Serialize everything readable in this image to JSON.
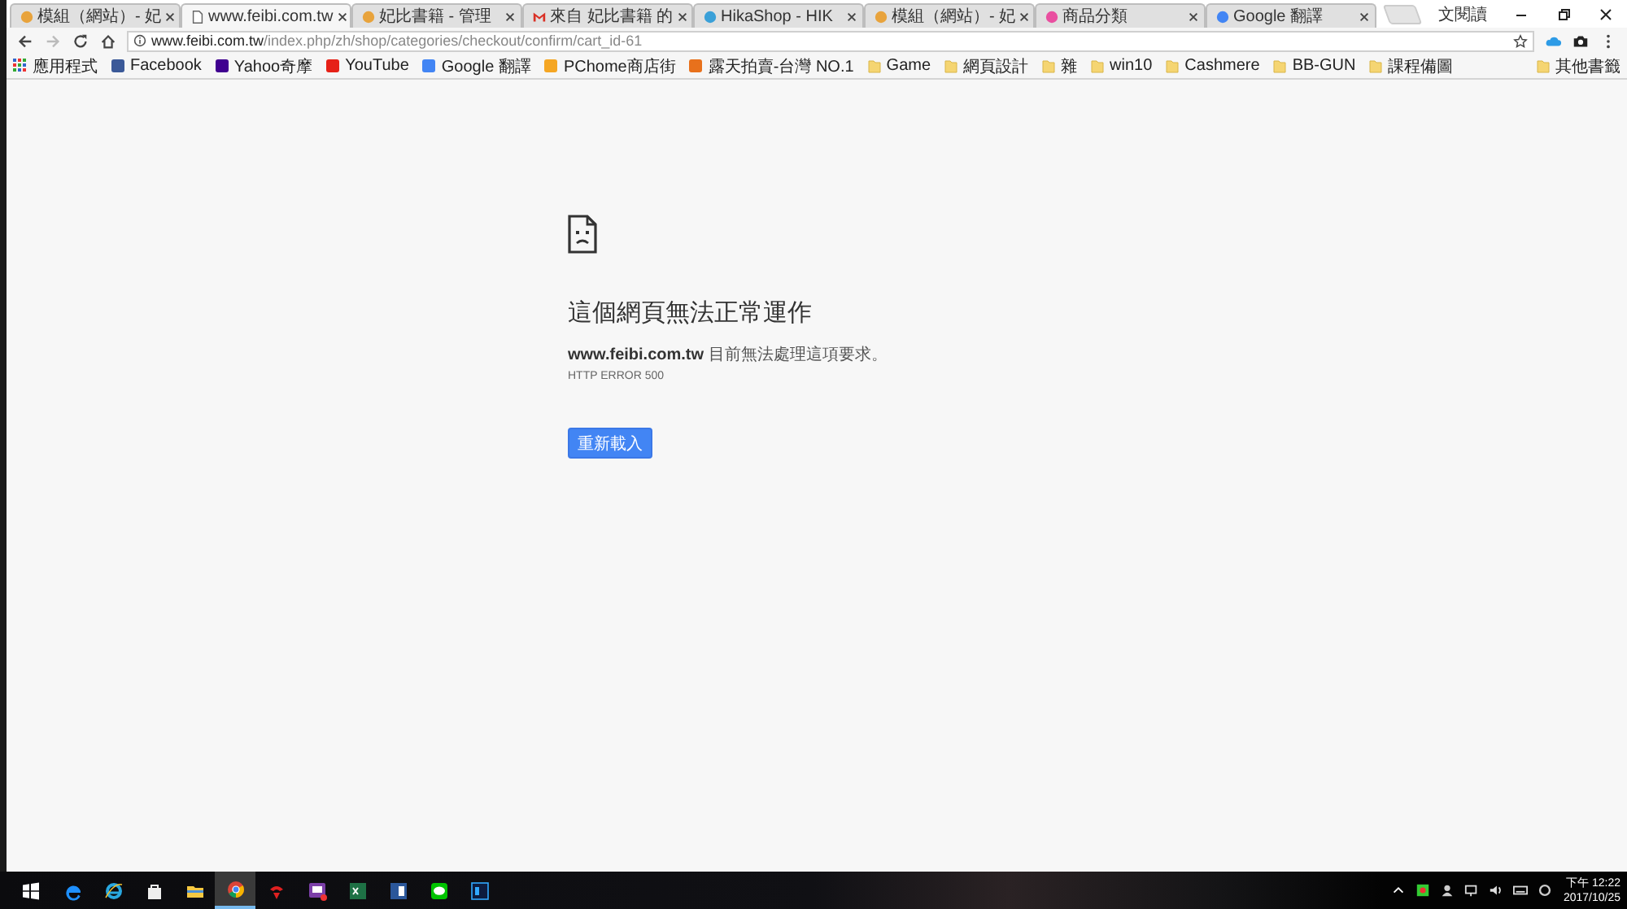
{
  "tabs": [
    {
      "title": "模組（網站）- 妃",
      "kind": "joomla",
      "selected": false
    },
    {
      "title": "www.feibi.com.tw",
      "kind": "page",
      "selected": true
    },
    {
      "title": "妃比書籍 - 管理",
      "kind": "joomla",
      "selected": false
    },
    {
      "title": "來自 妃比書籍 的",
      "kind": "gmail",
      "selected": false
    },
    {
      "title": "HikaShop - HIK",
      "kind": "hika",
      "selected": false
    },
    {
      "title": "模組（網站）- 妃",
      "kind": "joomla",
      "selected": false
    },
    {
      "title": "商品分類",
      "kind": "pink",
      "selected": false
    },
    {
      "title": "Google 翻譯",
      "kind": "translate",
      "selected": false
    }
  ],
  "profile": "文閱讀",
  "address": {
    "host": "www.feibi.com.tw",
    "path": "/index.php/zh/shop/categories/checkout/confirm/cart_id-61"
  },
  "bookmarks": [
    {
      "label": "應用程式",
      "kind": "apps"
    },
    {
      "label": "Facebook",
      "kind": "facebook"
    },
    {
      "label": "Yahoo奇摩",
      "kind": "yahoo"
    },
    {
      "label": "YouTube",
      "kind": "youtube"
    },
    {
      "label": "Google 翻譯",
      "kind": "translate"
    },
    {
      "label": "PChome商店街",
      "kind": "pchome"
    },
    {
      "label": "露天拍賣-台灣 NO.1",
      "kind": "ruten"
    },
    {
      "label": "Game",
      "kind": "folder"
    },
    {
      "label": "網頁設計",
      "kind": "folder"
    },
    {
      "label": "雜",
      "kind": "folder"
    },
    {
      "label": "win10",
      "kind": "folder"
    },
    {
      "label": "Cashmere",
      "kind": "folder"
    },
    {
      "label": "BB-GUN",
      "kind": "folder"
    },
    {
      "label": "課程備圖",
      "kind": "folder"
    }
  ],
  "other_bookmarks": "其他書籤",
  "error": {
    "title": "這個網頁無法正常運作",
    "message": "**www.feibi.com.tw** 目前無法處理這項要求。",
    "code": "HTTP ERROR 500",
    "button": "重新載入"
  },
  "taskbar": {
    "apps": [
      {
        "kind": "edge",
        "active": false
      },
      {
        "kind": "ie",
        "active": false
      },
      {
        "kind": "store",
        "active": false
      },
      {
        "kind": "explorer",
        "active": false
      },
      {
        "kind": "chrome",
        "active": true
      },
      {
        "kind": "red",
        "active": false
      },
      {
        "kind": "purple",
        "active": false
      },
      {
        "kind": "excel",
        "active": false
      },
      {
        "kind": "word",
        "active": false
      },
      {
        "kind": "line",
        "active": false
      },
      {
        "kind": "photoshop",
        "active": false
      }
    ],
    "time": "下午 12:22",
    "date": "2017/10/25"
  }
}
